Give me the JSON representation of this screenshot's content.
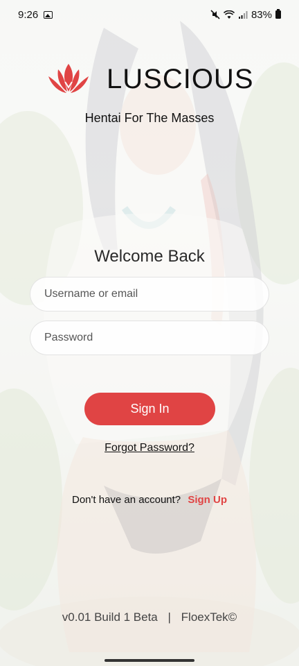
{
  "status_bar": {
    "time": "9:26",
    "battery": "83%",
    "icons": [
      "gallery-icon",
      "mute-icon",
      "wifi-icon",
      "signal-icon",
      "battery-icon"
    ]
  },
  "brand": {
    "name": "LUSCIOUS",
    "tagline": "Hentai For The Masses",
    "logo_color": "#e04444"
  },
  "login": {
    "heading": "Welcome Back",
    "username_placeholder": "Username or email",
    "password_placeholder": "Password",
    "sign_in_label": "Sign In",
    "forgot_label": "Forgot Password?",
    "no_account_text": "Don't have an account?",
    "sign_up_label": "Sign Up"
  },
  "footer": {
    "version": "v0.01 Build 1 Beta",
    "separator": "|",
    "company": "FloexTek©"
  },
  "colors": {
    "accent": "#e04444",
    "text": "#111111"
  }
}
